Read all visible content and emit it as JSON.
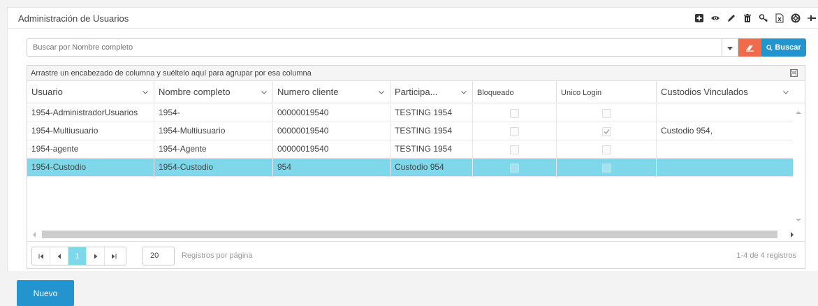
{
  "panel": {
    "title": "Administración de Usuarios",
    "toolbar_icons": [
      "plus-square-icon",
      "eye-icon",
      "pencil-icon",
      "trash-icon",
      "key-icon",
      "excel-icon",
      "lifebuoy-icon",
      "pin-icon"
    ]
  },
  "search": {
    "placeholder": "Buscar por Nombre completo",
    "value": "",
    "button_label": "Buscar"
  },
  "grid": {
    "group_hint": "Arrastre un encabezado de columna y suéltelo aquí para agrupar por esa columna",
    "columns": [
      {
        "label": "Usuario",
        "has_menu": true
      },
      {
        "label": "Nombre completo",
        "has_menu": true
      },
      {
        "label": "Numero cliente",
        "has_menu": true
      },
      {
        "label": "Participa...",
        "has_menu": true
      },
      {
        "label": "Bloqueado",
        "has_menu": false
      },
      {
        "label": "Unico Login",
        "has_menu": false
      },
      {
        "label": "Custodios Vinculados",
        "has_menu": true
      }
    ],
    "rows": [
      {
        "usuario": "1954-AdministradorUsuarios",
        "nombre": "1954-",
        "cliente": "00000019540",
        "participante": "TESTING 1954",
        "bloqueado": false,
        "unico_login": false,
        "custodios": "",
        "selected": false
      },
      {
        "usuario": "1954-Multiusuario",
        "nombre": "1954-Multiusuario",
        "cliente": "00000019540",
        "participante": "TESTING 1954",
        "bloqueado": false,
        "unico_login": true,
        "custodios": "Custodio 954,",
        "selected": false
      },
      {
        "usuario": "1954-agente",
        "nombre": "1954-Agente",
        "cliente": "00000019540",
        "participante": "TESTING 1954",
        "bloqueado": false,
        "unico_login": false,
        "custodios": "",
        "selected": false
      },
      {
        "usuario": "1954-Custodio",
        "nombre": "1954-Custodio",
        "cliente": "954",
        "participante": "Custodio 954",
        "bloqueado": false,
        "unico_login": false,
        "custodios": "",
        "selected": true
      }
    ]
  },
  "pager": {
    "current_page": "1",
    "page_size": "20",
    "page_size_label": "Registros por página",
    "info": "1-4 de 4 registros"
  },
  "actions": {
    "new_label": "Nuevo"
  },
  "colors": {
    "primary": "#2494cf",
    "selected_row": "#7fd7ea",
    "clear_button": "#f06a4c"
  }
}
